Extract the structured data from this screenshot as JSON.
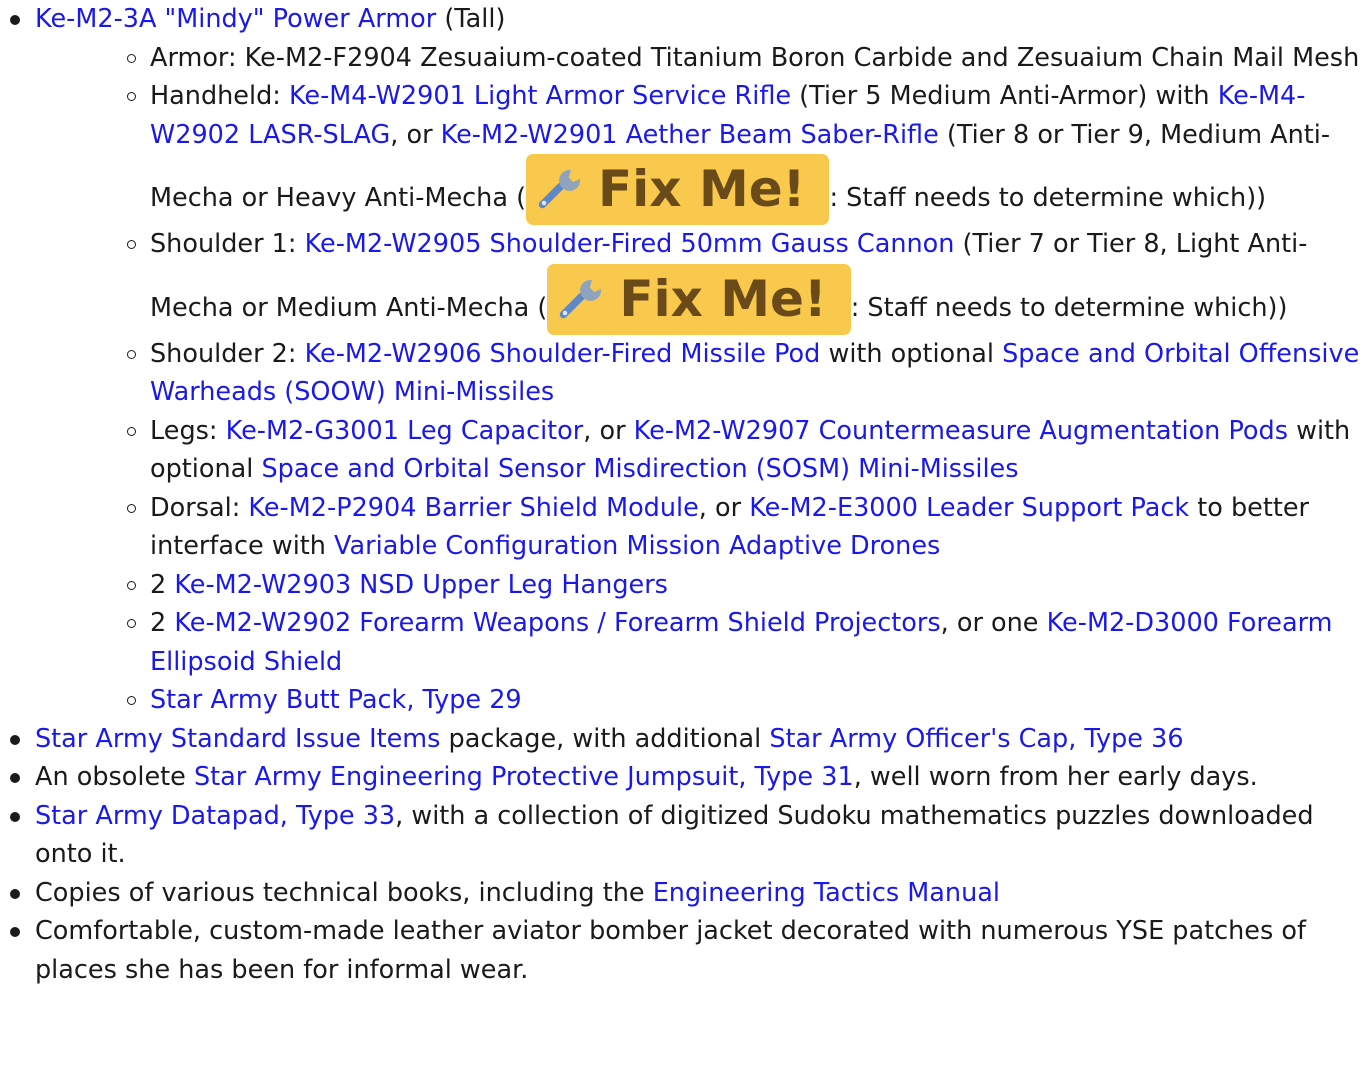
{
  "armor": {
    "link": "Ke-M2-3A \"Mindy\" Power Armor",
    "suffix": " (Tall)",
    "items": {
      "armor": {
        "text": "Armor: Ke-M2-F2904 Zesuaium-coated Titanium Boron Carbide and Zesuaium Chain Mail Mesh"
      },
      "handheld": {
        "prefix": "Handheld: ",
        "link1": "Ke-M4-W2901 Light Armor Service Rifle",
        "mid1": " (Tier 5 Medium Anti-Armor) with ",
        "link2": "Ke-M4-W2902 LASR-SLAG",
        "mid2": ", or ",
        "link3": "Ke-M2-W2901 Aether Beam Saber-Rifle",
        "mid3": " (Tier 8 or Tier 9, Medium Anti-Mecha or Heavy Anti-Mecha (",
        "suffix": ": Staff needs to determine which))"
      },
      "shoulder1": {
        "prefix": "Shoulder 1: ",
        "link1": "Ke-M2-W2905 Shoulder-Fired 50mm Gauss Cannon",
        "mid1": " (Tier 7 or Tier 8, Light Anti-Mecha or Medium Anti-Mecha (",
        "suffix": ": Staff needs to determine which))"
      },
      "shoulder2": {
        "prefix": "Shoulder 2: ",
        "link1": "Ke-M2-W2906 Shoulder-Fired Missile Pod",
        "mid1": " with optional ",
        "link2": "Space and Orbital Offensive Warheads (SOOW) Mini-Missiles"
      },
      "legs": {
        "prefix": "Legs: ",
        "link1": "Ke-M2-G3001 Leg Capacitor",
        "mid1": ", or ",
        "link2": "Ke-M2-W2907 Countermeasure Augmentation Pods",
        "mid2": " with optional ",
        "link3": "Space and Orbital Sensor Misdirection (SOSM) Mini-Missiles"
      },
      "dorsal": {
        "prefix": "Dorsal: ",
        "link1": "Ke-M2-P2904 Barrier Shield Module",
        "mid1": ", or ",
        "link2": "Ke-M2-E3000 Leader Support Pack",
        "mid2": " to better interface with ",
        "link3": "Variable Configuration Mission Adaptive Drones"
      },
      "leg_hangers": {
        "prefix": "2 ",
        "link1": "Ke-M2-W2903 NSD Upper Leg Hangers"
      },
      "forearm": {
        "prefix": "2 ",
        "link1": "Ke-M2-W2902 Forearm Weapons / Forearm Shield Projectors",
        "mid1": ", or one ",
        "link2": "Ke-M2-D3000 Forearm Ellipsoid Shield"
      },
      "butt_pack": {
        "link1": "Star Army Butt Pack, Type 29"
      }
    }
  },
  "fixme": {
    "label": "Fix Me!",
    "icon": "wrench-icon",
    "bg_color": "#f8c94d",
    "text_color": "#6b4a1a"
  },
  "items": {
    "standard_issue": {
      "link1": "Star Army Standard Issue Items",
      "mid1": " package, with additional ",
      "link2": "Star Army Officer's Cap, Type 36"
    },
    "jumpsuit": {
      "prefix": "An obsolete ",
      "link1": "Star Army Engineering Protective Jumpsuit, Type 31",
      "suffix": ", well worn from her early days."
    },
    "datapad": {
      "link1": "Star Army Datapad, Type 33",
      "suffix": ", with a collection of digitized Sudoku mathematics puzzles downloaded onto it."
    },
    "books": {
      "prefix": "Copies of various technical books, including the ",
      "link1": "Engineering Tactics Manual"
    },
    "jacket": {
      "text": "Comfortable, custom-made leather aviator bomber jacket decorated with numerous YSE patches of places she has been for informal wear."
    }
  },
  "colors": {
    "link": "#1b19ea",
    "text": "#1a1a1a"
  }
}
